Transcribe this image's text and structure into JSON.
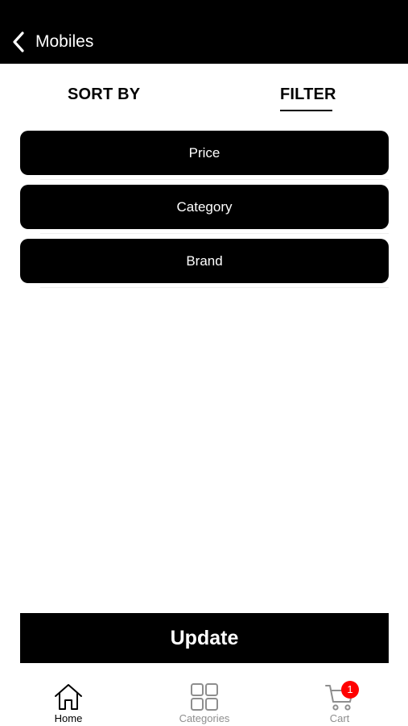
{
  "header": {
    "title": "Mobiles",
    "back_icon": "chevron-left-icon"
  },
  "tabs": [
    {
      "label": "SORT BY",
      "active": false
    },
    {
      "label": "FILTER",
      "active": true
    }
  ],
  "filters": [
    {
      "label": "Price"
    },
    {
      "label": "Category"
    },
    {
      "label": "Brand"
    }
  ],
  "update_button": {
    "label": "Update"
  },
  "tabbar": {
    "items": [
      {
        "label": "Home",
        "icon": "home-icon",
        "active": true
      },
      {
        "label": "Categories",
        "icon": "grid-icon",
        "active": false
      },
      {
        "label": "Cart",
        "icon": "cart-icon",
        "active": false,
        "badge": "1"
      }
    ]
  },
  "colors": {
    "primary": "#000000",
    "background": "#ffffff",
    "inactive_tab": "#8e8e8e",
    "badge": "#ff0000"
  }
}
